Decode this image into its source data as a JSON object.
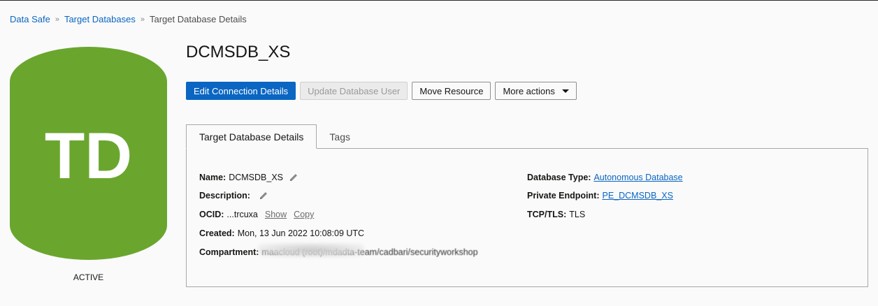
{
  "breadcrumb": {
    "items": [
      "Data Safe",
      "Target Databases"
    ],
    "separator": "»",
    "current": "Target Database Details"
  },
  "resource": {
    "initials": "TD",
    "status": "ACTIVE",
    "icon_color": "#6aa62e",
    "title": "DCMSDB_XS"
  },
  "actions": {
    "edit_connection": "Edit Connection Details",
    "update_user": "Update Database User",
    "move_resource": "Move Resource",
    "more_actions": "More actions"
  },
  "tabs": [
    {
      "label": "Target Database Details",
      "active": true
    },
    {
      "label": "Tags",
      "active": false
    }
  ],
  "details": {
    "name_label": "Name:",
    "name_value": "DCMSDB_XS",
    "description_label": "Description:",
    "ocid_label": "OCID:",
    "ocid_value": "...trcuxa",
    "show_link": "Show",
    "copy_link": "Copy",
    "created_label": "Created:",
    "created_value": "Mon, 13 Jun 2022 10:08:09 UTC",
    "compartment_label": "Compartment:",
    "compartment_value": "maacloud (root)/mdadta-team/cadbari/securityworkshop",
    "db_type_label": "Database Type:",
    "db_type_value": "Autonomous Database",
    "private_endpoint_label": "Private Endpoint:",
    "private_endpoint_value": "PE_DCMSDB_XS",
    "tcp_tls_label": "TCP/TLS:",
    "tcp_tls_value": "TLS"
  },
  "colors": {
    "accent": "#0a66c2",
    "active_green": "#6aa62e"
  },
  "icons": {
    "edit": "pencil-icon",
    "dropdown": "chevron-down-icon"
  }
}
